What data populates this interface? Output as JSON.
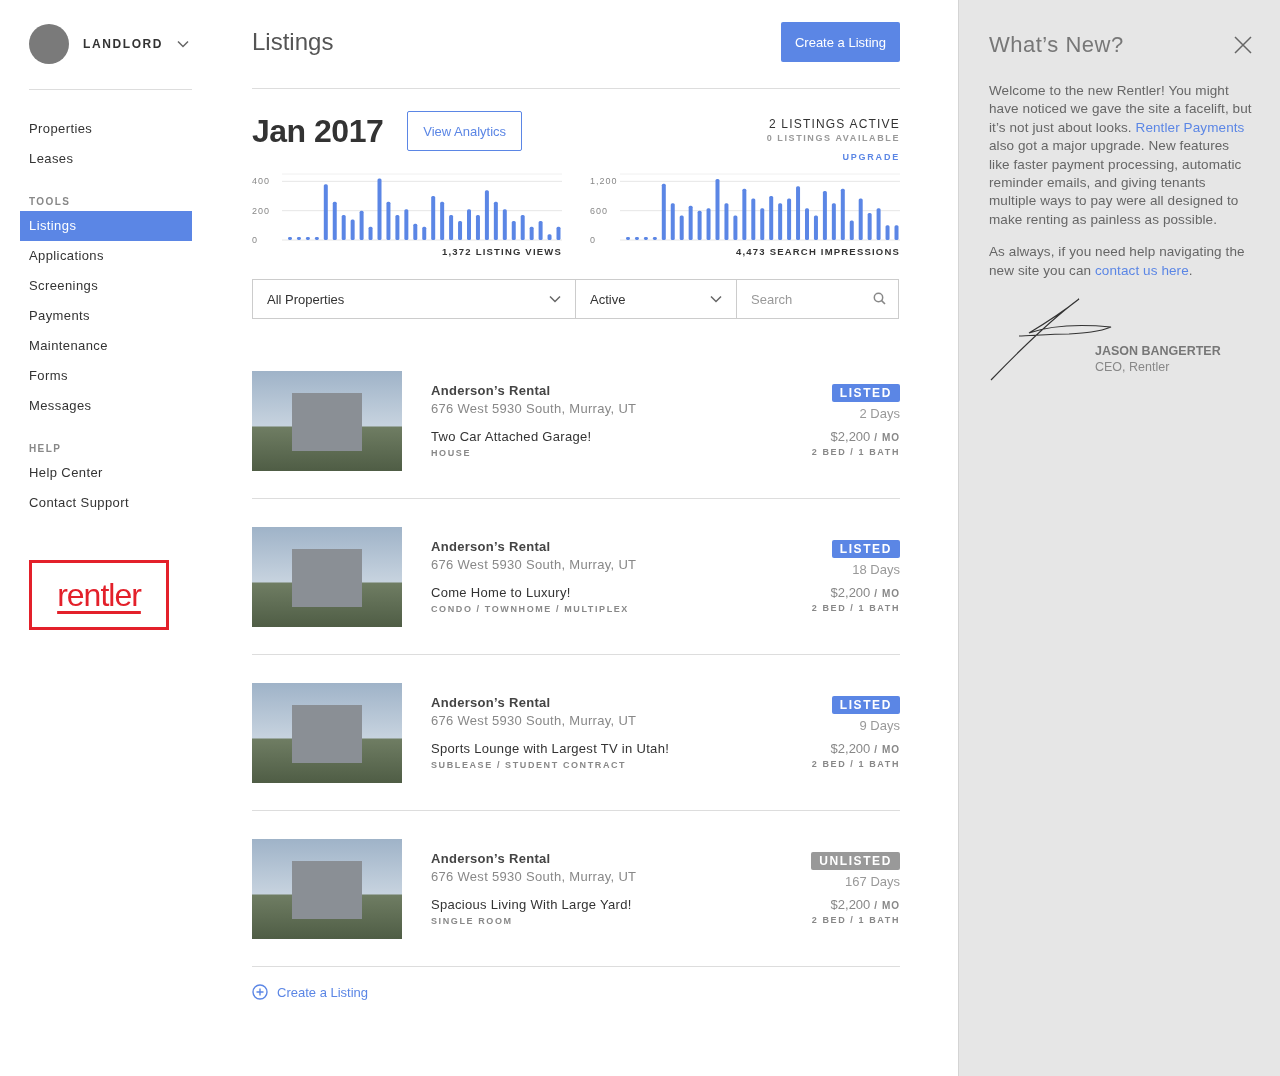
{
  "user": {
    "role": "LANDLORD"
  },
  "sidebar": {
    "items": [
      {
        "label": "Properties",
        "selected": false
      },
      {
        "label": "Leases",
        "selected": false
      }
    ],
    "sections": [
      {
        "heading": "TOOLS",
        "items": [
          {
            "label": "Listings",
            "selected": true
          },
          {
            "label": "Applications",
            "selected": false
          },
          {
            "label": "Screenings",
            "selected": false
          },
          {
            "label": "Payments",
            "selected": false
          },
          {
            "label": "Maintenance",
            "selected": false
          },
          {
            "label": "Forms",
            "selected": false
          },
          {
            "label": "Messages",
            "selected": false
          }
        ]
      },
      {
        "heading": "HELP",
        "items": [
          {
            "label": "Help Center",
            "selected": false
          },
          {
            "label": "Contact Support",
            "selected": false
          }
        ]
      }
    ],
    "logo": "rentler"
  },
  "main": {
    "title": "Listings",
    "create_button": "Create a Listing",
    "period": "Jan 2017",
    "analytics_button": "View Analytics",
    "active_count": "2 LISTINGS ACTIVE",
    "available_count": "0 LISTINGS AVAILABLE",
    "upgrade_link": "UPGRADE",
    "charts": [
      {
        "chart_data": {
          "type": "bar",
          "title": "1,372 LISTING VIEWS",
          "series": [
            {
              "color": "#5b86e5",
              "values": [
                20,
                20,
                20,
                20,
                380,
                260,
                170,
                140,
                200,
                90,
                420,
                260,
                170,
                210,
                110,
                90,
                300,
                260,
                170,
                130,
                210,
                170,
                340,
                260,
                210,
                130,
                170,
                90,
                130,
                40,
                90
              ]
            }
          ],
          "ylim": [
            0,
            450
          ],
          "yticks": [
            0,
            {
              "value": 200,
              "label": "200"
            },
            {
              "value": 400,
              "label": "400"
            }
          ]
        }
      },
      {
        "chart_data": {
          "type": "bar",
          "title": "4,473 SEARCH IMPRESSIONS",
          "series": [
            {
              "color": "#5b86e5",
              "values": [
                60,
                60,
                60,
                60,
                1150,
                750,
                500,
                700,
                600,
                650,
                1250,
                750,
                500,
                1050,
                850,
                650,
                900,
                750,
                850,
                1100,
                650,
                500,
                1000,
                750,
                1050,
                400,
                850,
                550,
                650,
                300,
                300
              ]
            }
          ],
          "ylim": [
            0,
            1350
          ],
          "yticks": [
            0,
            {
              "value": 600,
              "label": "600"
            },
            {
              "value": 1200,
              "label": "1,200"
            }
          ]
        }
      }
    ],
    "filters": {
      "property": "All Properties",
      "status": "Active",
      "search_placeholder": "Search"
    },
    "listings": [
      {
        "name": "Anderson’s Rental",
        "address": "676 West 5930 South, Murray, UT",
        "headline": "Two Car Attached Garage!",
        "type": "HOUSE",
        "status": "LISTED",
        "listed": true,
        "days": "2 Days",
        "price": "$2,200",
        "period": "/ MO",
        "details": "2 BED / 1 BATH"
      },
      {
        "name": "Anderson’s Rental",
        "address": "676 West 5930 South, Murray, UT",
        "headline": "Come Home to Luxury!",
        "type": "CONDO / TOWNHOME / MULTIPLEX",
        "status": "LISTED",
        "listed": true,
        "days": "18 Days",
        "price": "$2,200",
        "period": "/ MO",
        "details": "2 BED / 1 BATH"
      },
      {
        "name": "Anderson’s Rental",
        "address": "676 West 5930 South, Murray, UT",
        "headline": "Sports Lounge with Largest TV in Utah!",
        "type": "SUBLEASE / STUDENT CONTRACT",
        "status": "LISTED",
        "listed": true,
        "days": "9 Days",
        "price": "$2,200",
        "period": "/ MO",
        "details": "2 BED / 1 BATH"
      },
      {
        "name": "Anderson’s Rental",
        "address": "676 West 5930 South, Murray, UT",
        "headline": "Spacious Living With Large Yard!",
        "type": "SINGLE ROOM",
        "status": "UNLISTED",
        "listed": false,
        "days": "167 Days",
        "price": "$2,200",
        "period": "/ MO",
        "details": "2 BED / 1 BATH"
      }
    ],
    "footer_link": "Create a Listing"
  },
  "news": {
    "title": "What’s New?",
    "paragraphs": [
      [
        {
          "kind": "text",
          "text": "Welcome to the new Rentler! You might have noticed we gave the site a facelift, but it’s not just about looks. "
        },
        {
          "kind": "link",
          "text": "Rentler Payments"
        },
        {
          "kind": "text",
          "text": " also got a major upgrade. New features like faster payment processing, automatic reminder emails, and giving tenants multiple ways to pay were all designed to make renting as painless as possible."
        }
      ],
      [
        {
          "kind": "text",
          "text": "As always, if you need help navigating the new site you can "
        },
        {
          "kind": "link",
          "text": "contact us here"
        },
        {
          "kind": "text",
          "text": "."
        }
      ]
    ],
    "signer": "JASON BANGERTER",
    "signer_title": "CEO, Rentler"
  }
}
